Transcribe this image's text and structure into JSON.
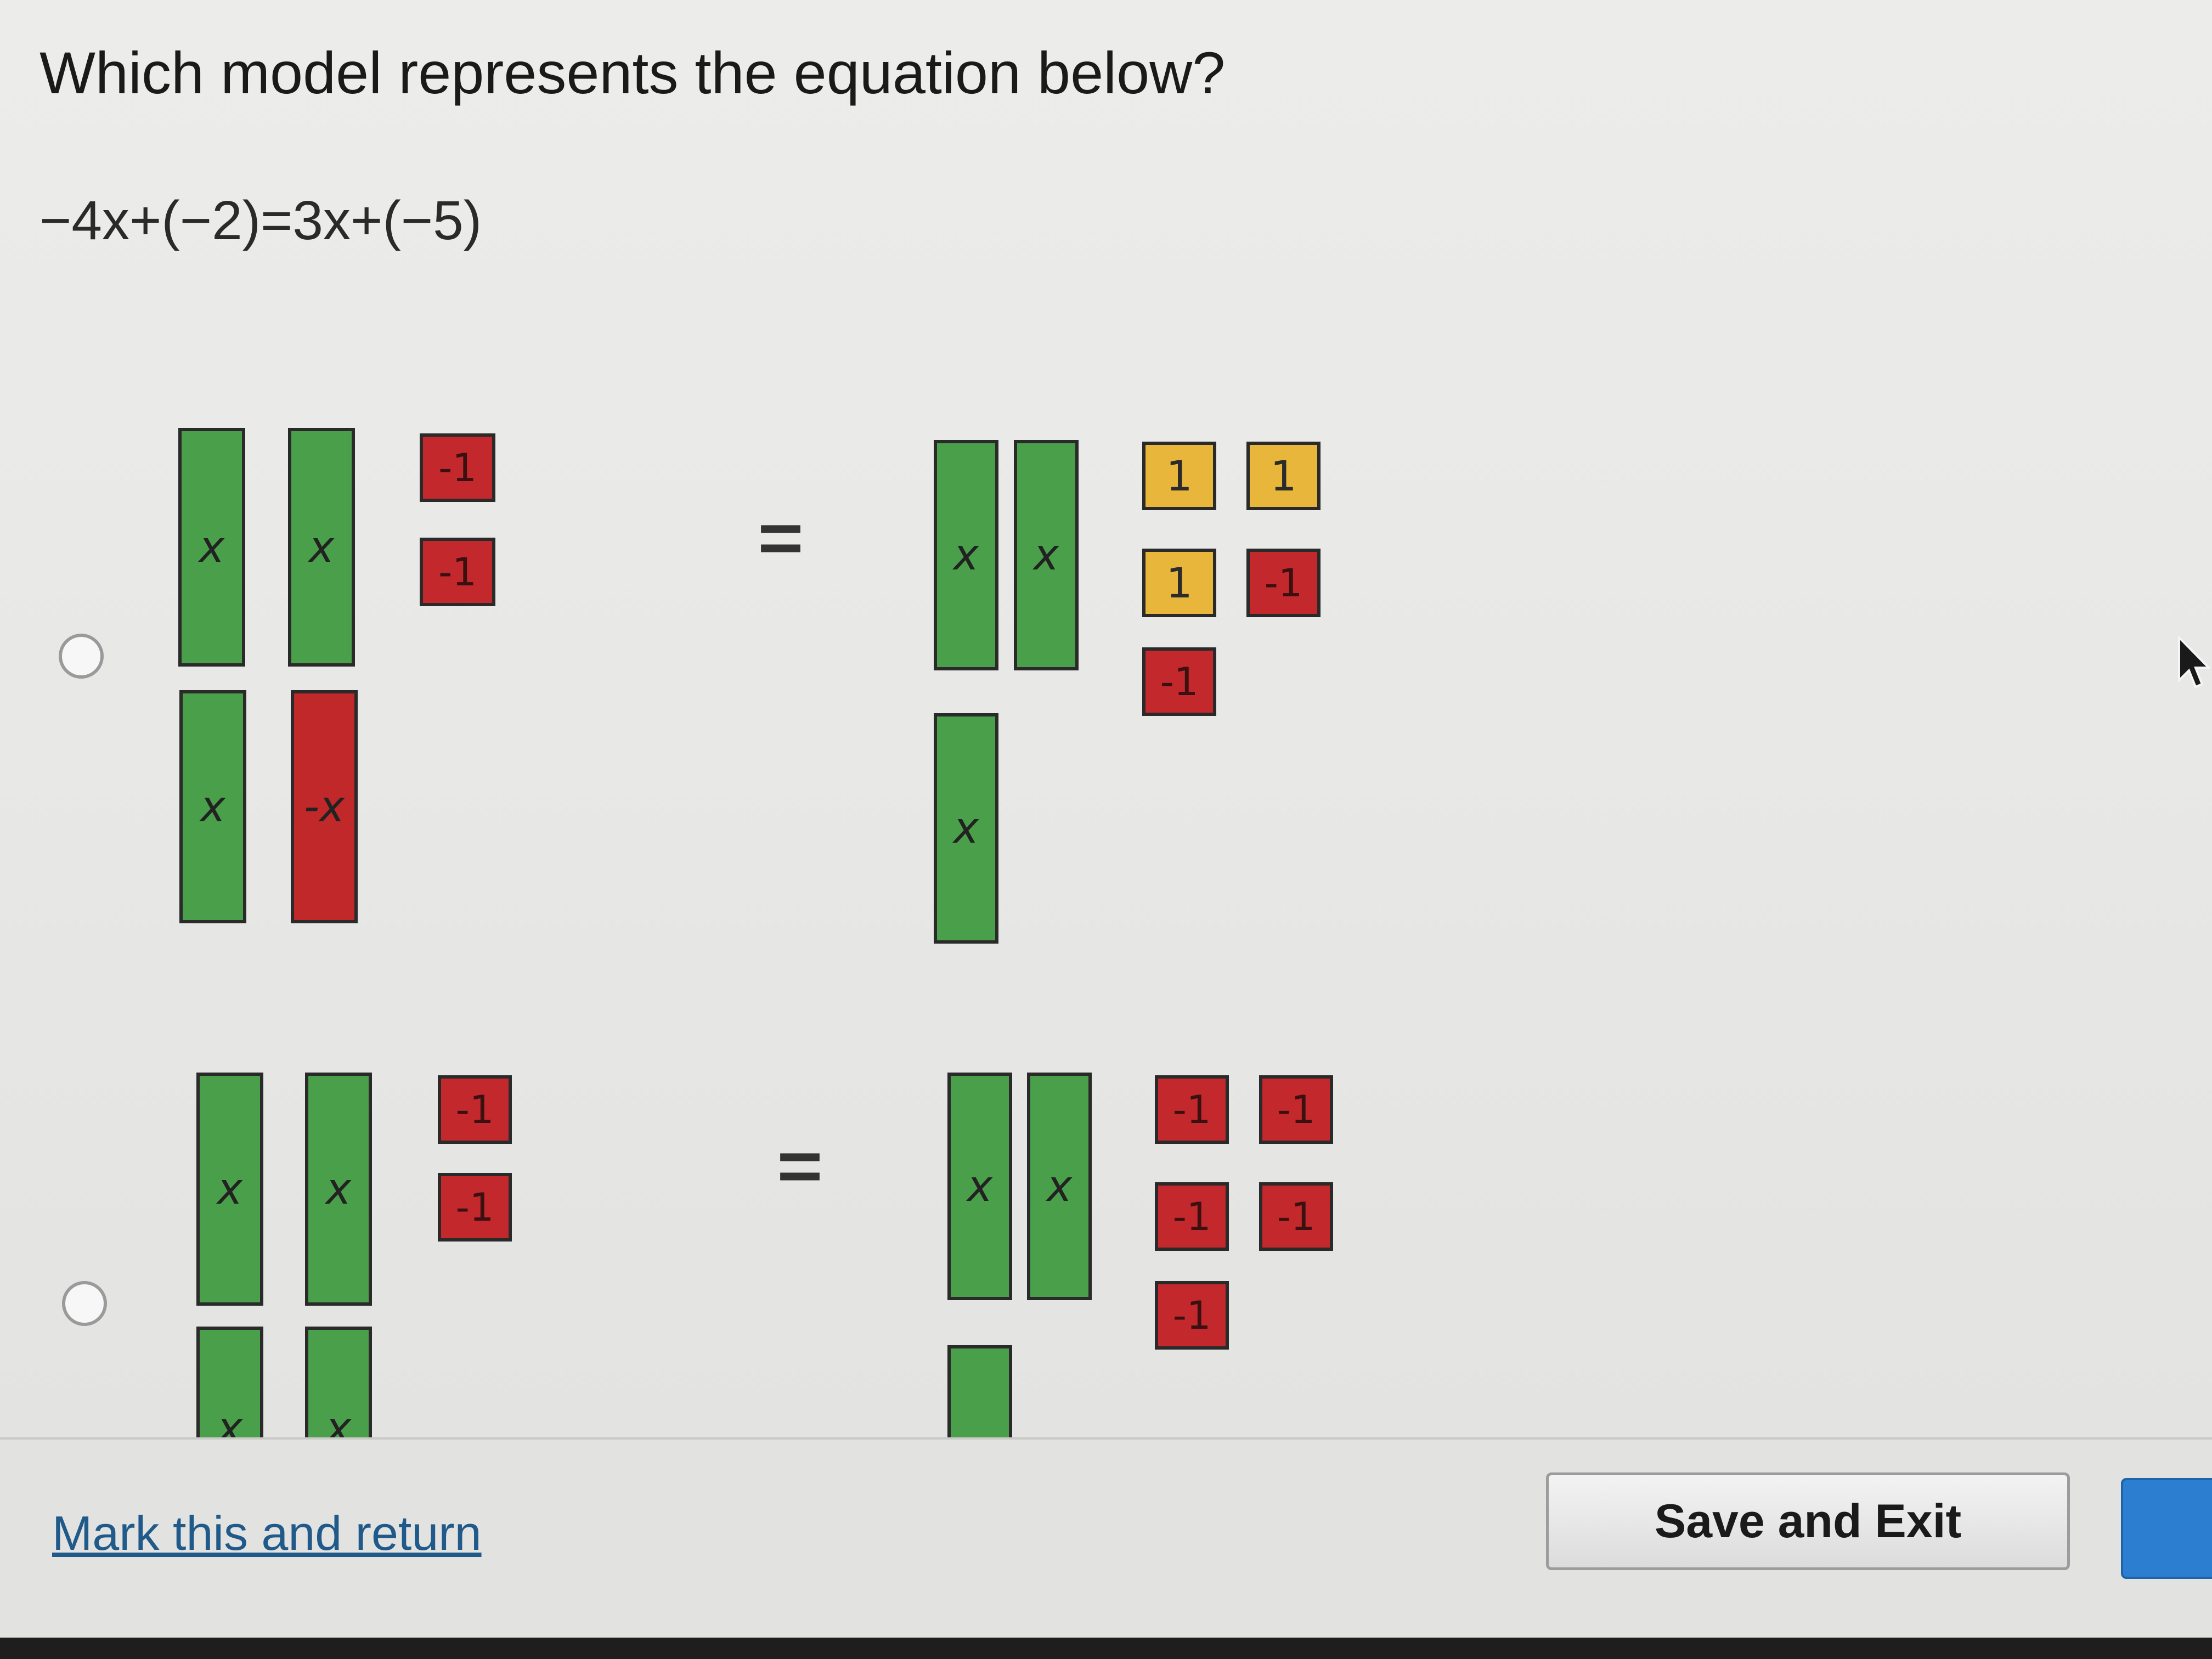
{
  "question": {
    "prompt": "Which model represents the equation below?",
    "equation": "−4x+(−2)=3x+(−5)"
  },
  "options": [
    {
      "equals_sign": "=",
      "left": {
        "x_tiles": [
          "x",
          "x",
          "x"
        ],
        "neg_x_tiles": [
          "-x"
        ],
        "neg_one_tiles": [
          "-1",
          "-1"
        ]
      },
      "right": {
        "x_tiles": [
          "x",
          "x",
          "x"
        ],
        "one_tiles": [
          "1",
          "1",
          "1"
        ],
        "neg_one_tiles": [
          "-1",
          "-1"
        ]
      }
    },
    {
      "equals_sign": "=",
      "left": {
        "x_tiles": [
          "x",
          "x",
          "x",
          "x"
        ],
        "neg_one_tiles": [
          "-1",
          "-1"
        ]
      },
      "right": {
        "x_tiles": [
          "x",
          "x",
          "x"
        ],
        "neg_one_tiles": [
          "-1",
          "-1",
          "-1",
          "-1",
          "-1"
        ]
      }
    }
  ],
  "footer": {
    "mark_link": "Mark this and return",
    "save_exit": "Save and Exit"
  },
  "colors": {
    "x_tile": "#4aa04a",
    "neg_tile": "#c2282c",
    "one_tile": "#e9b63c",
    "link": "#1f5a8a",
    "next_button": "#2c7fd0"
  },
  "icons": {
    "cursor": "mouse-pointer-icon"
  }
}
